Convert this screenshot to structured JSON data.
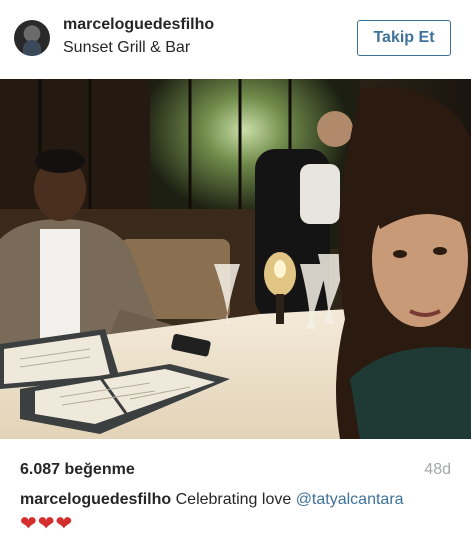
{
  "post": {
    "username": "marceloguedesfilho",
    "location": "Sunset Grill & Bar",
    "follow_label": "Takip Et",
    "likes": "6.087 beğenme",
    "age": "48d",
    "caption_user": "marceloguedesfilho",
    "caption_text": "Celebrating love",
    "caption_mention": "@tatyalcantara",
    "caption_emoji": "❤❤❤"
  },
  "colors": {
    "link": "#3f729b",
    "muted": "#a5a7aa",
    "text": "#262626",
    "heart": "#d32f2f"
  }
}
